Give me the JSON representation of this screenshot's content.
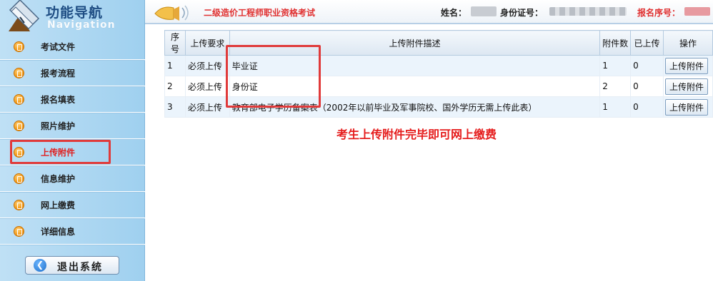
{
  "nav": {
    "title": "功能导航",
    "subtitle": "Navigation",
    "items": [
      {
        "label": "考试文件"
      },
      {
        "label": "报考流程"
      },
      {
        "label": "报名填表"
      },
      {
        "label": "照片维护"
      },
      {
        "label": "上传附件"
      },
      {
        "label": "信息维护"
      },
      {
        "label": "网上缴费"
      },
      {
        "label": "详细信息"
      }
    ],
    "active_item": "上传附件",
    "logout_label": "退出系统"
  },
  "header": {
    "exam_title": "二级造价工程师职业资格考试",
    "name_label": "姓名：",
    "id_label": "身份证号：",
    "reg_label": "报名序号："
  },
  "table": {
    "headers": [
      "序号",
      "上传要求",
      "上传附件描述",
      "附件数",
      "已上传",
      "操作"
    ],
    "rows": [
      {
        "no": "1",
        "req": "必须上传",
        "desc": "毕业证",
        "count": "1",
        "uploaded": "0",
        "action": "上传附件"
      },
      {
        "no": "2",
        "req": "必须上传",
        "desc": "身份证",
        "count": "2",
        "uploaded": "0",
        "action": "上传附件"
      },
      {
        "no": "3",
        "req": "必须上传",
        "desc": "教育部电子学历备案表（2002年以前毕业及军事院校、国外学历无需上传此表）",
        "count": "1",
        "uploaded": "0",
        "action": "上传附件"
      }
    ]
  },
  "notice": "考生上传附件完毕即可网上缴费",
  "colors": {
    "accent_red": "#e51c1c",
    "sidebar_bg": "#a9d5f1",
    "header_blue": "#1f4e84"
  },
  "icons": [
    "pen-logo-icon",
    "megaphone-icon",
    "document-icon",
    "back-arrow-icon"
  ]
}
